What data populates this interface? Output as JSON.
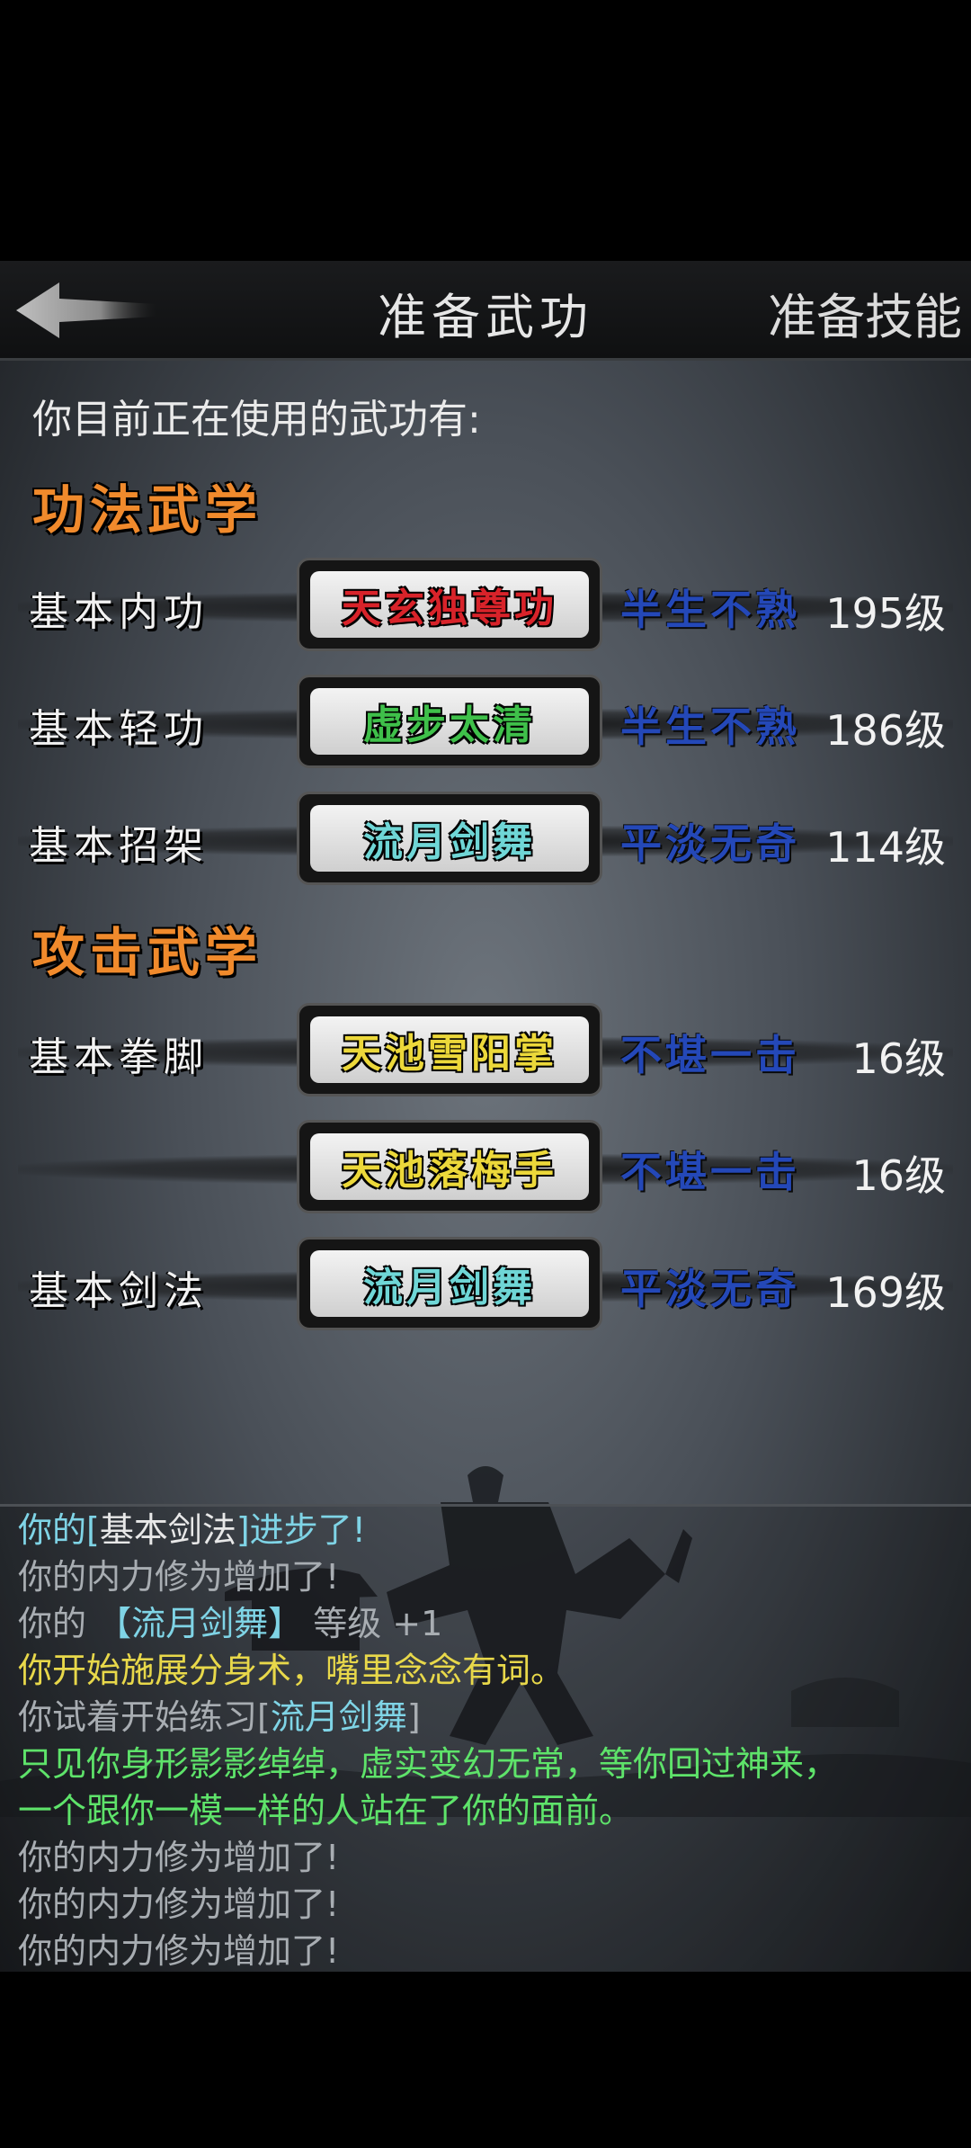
{
  "colors": {
    "orange_title": "#f08a2c",
    "red_skill": "#d8232a",
    "green_skill": "#3fc04a",
    "cyan_skill": "#6fd6d6",
    "yellow_skill": "#ecd83a",
    "prof_blue": "#2448b8",
    "log_cyan": "#7fd4e6",
    "log_gray": "#a8adb2",
    "log_yellow": "#e8d84a",
    "log_green": "#5ee36a"
  },
  "header": {
    "back_icon": "left-arrow-icon",
    "title": "准备武功",
    "skills_link": "准备技能"
  },
  "intro": "你目前正在使用的武功有:",
  "sections": {
    "internal": "功法武学",
    "attack": "攻击武学"
  },
  "rows": [
    {
      "category": "基本内功",
      "skill": "天玄独尊功",
      "skill_color": "#d8232a",
      "proficiency": "半生不熟",
      "level": "195级"
    },
    {
      "category": "基本轻功",
      "skill": "虚步太清",
      "skill_color": "#3fc04a",
      "proficiency": "半生不熟",
      "level": "186级"
    },
    {
      "category": "基本招架",
      "skill": "流月剑舞",
      "skill_color": "#6fd6d6",
      "proficiency": "平淡无奇",
      "level": "114级"
    },
    {
      "category": "基本拳脚",
      "skill": "天池雪阳掌",
      "skill_color": "#ecd83a",
      "proficiency": "不堪一击",
      "level": "16级"
    },
    {
      "category": "",
      "skill": "天池落梅手",
      "skill_color": "#ecd83a",
      "proficiency": "不堪一击",
      "level": "16级"
    },
    {
      "category": "基本剑法",
      "skill": "流月剑舞",
      "skill_color": "#6fd6d6",
      "proficiency": "平淡无奇",
      "level": "169级"
    }
  ],
  "log": [
    {
      "parts": [
        {
          "t": "你的[",
          "c": "#7fd4e6"
        },
        {
          "t": "基本剑法",
          "c": "#e8e8e8"
        },
        {
          "t": "]进步了!",
          "c": "#7fd4e6"
        }
      ]
    },
    {
      "parts": [
        {
          "t": "你的内力修为增加了!",
          "c": "#a8adb2"
        }
      ]
    },
    {
      "parts": [
        {
          "t": "你的 ",
          "c": "#a8adb2"
        },
        {
          "t": "【流月剑舞】",
          "c": "#7fd4e6"
        },
        {
          "t": " 等级 +1",
          "c": "#a8adb2"
        }
      ]
    },
    {
      "parts": [
        {
          "t": "你开始施展分身术，嘴里念念有词。",
          "c": "#e8d84a"
        }
      ]
    },
    {
      "parts": [
        {
          "t": "你试着开始练习[",
          "c": "#a8adb2"
        },
        {
          "t": "流月剑舞",
          "c": "#7fd4e6"
        },
        {
          "t": "]",
          "c": "#a8adb2"
        }
      ]
    },
    {
      "parts": [
        {
          "t": "只见你身形影影绰绰，虚实变幻无常，等你回过神来，",
          "c": "#5ee36a"
        }
      ]
    },
    {
      "parts": [
        {
          "t": "一个跟你一模一样的人站在了你的面前。",
          "c": "#5ee36a"
        }
      ]
    },
    {
      "parts": [
        {
          "t": "你的内力修为增加了!",
          "c": "#a8adb2"
        }
      ]
    },
    {
      "parts": [
        {
          "t": "你的内力修为增加了!",
          "c": "#a8adb2"
        }
      ]
    },
    {
      "parts": [
        {
          "t": "你的内力修为增加了!",
          "c": "#a8adb2"
        }
      ]
    }
  ]
}
